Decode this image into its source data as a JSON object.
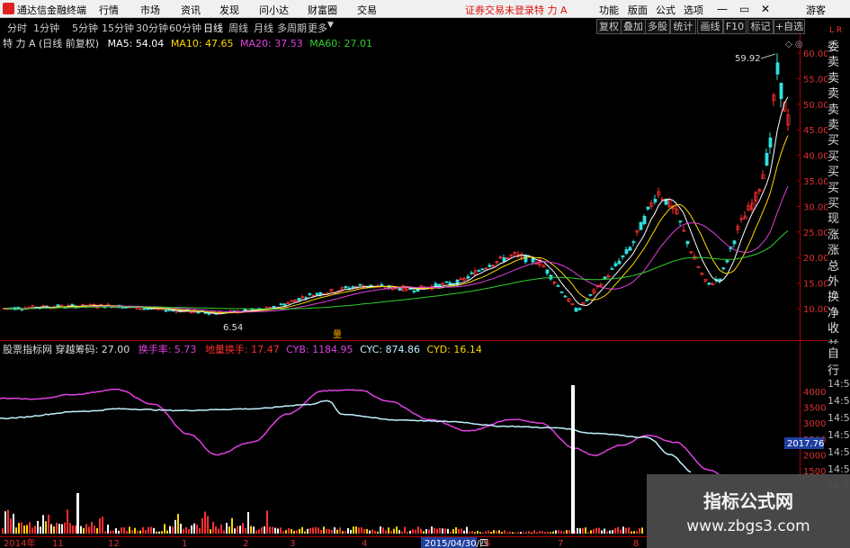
{
  "menubar": {
    "app_title": "通达信金融终端",
    "menus": [
      "行情",
      "市场",
      "资讯",
      "发现",
      "问小达",
      "财富圈",
      "交易"
    ],
    "trade_status": "证券交易未登录",
    "stock_name": "特 力 A",
    "right_menus": [
      "功能",
      "版面",
      "公式",
      "选项"
    ],
    "user": "游客"
  },
  "timeframes": [
    "分时",
    "1分钟",
    "5分钟",
    "15分钟",
    "30分钟",
    "60分钟",
    "日线",
    "周线",
    "月线",
    "多周期",
    "更多"
  ],
  "active_timeframe": "日线",
  "toolbar": [
    "复权",
    "叠加",
    "多股",
    "统计",
    "画线",
    "F10",
    "标记",
    "+自选"
  ],
  "ma_legend": {
    "title": "特 力 A (日线 前复权)",
    "ma5": "MA5: 54.04",
    "ma10": "MA10: 47.65",
    "ma20": "MA20: 37.53",
    "ma60": "MA60: 27.01"
  },
  "indicator_legend": {
    "title": "股票指标网 穿越筹码: 27.00",
    "hsl": "换手率: 5.73",
    "dlhs": "地量换手: 17.47",
    "cyb": "CYB: 1184.95",
    "cyc": "CYC: 874.86",
    "cyd": "CYD: 16.14"
  },
  "price_axis": [
    "60.00",
    "55.00",
    "50.00",
    "45.00",
    "40.00",
    "35.00",
    "30.00",
    "25.00",
    "20.00",
    "15.00",
    "10.00"
  ],
  "price_annotations": {
    "high": "59.92",
    "low": "6.54",
    "marker": "量"
  },
  "indicator_axis": [
    "4000",
    "3500",
    "3000",
    "2500",
    "2000",
    "1500"
  ],
  "indicator_current": "2017.76",
  "date_axis": [
    "2014年",
    "11",
    "12",
    "1",
    "2",
    "3",
    "4",
    "2015/04/30/四",
    "6",
    "7",
    "8"
  ],
  "right_side_panel": [
    "委比",
    "卖五",
    "卖四",
    "卖三",
    "卖二",
    "卖一",
    "买一",
    "买二",
    "买三",
    "买四",
    "买五",
    "现价",
    "涨跌",
    "涨幅",
    "总量",
    "外盘",
    "换手",
    "净资",
    "收益"
  ],
  "right_side_bottom": [
    "自动",
    "行情",
    "14:50",
    "14:50",
    "14:50",
    "14:50",
    "14:50",
    "14:50",
    "14:50"
  ],
  "watermark": {
    "title": "指标公式网",
    "url": "www.zbgs3.com"
  },
  "colors": {
    "ma5": "#ffffff",
    "ma10": "#ffd700",
    "ma20": "#e040e0",
    "ma60": "#30d030",
    "up": "#ff3030",
    "down": "#30e0e0",
    "cyb": "#e040e0",
    "cyc": "#c0f0ff"
  }
}
